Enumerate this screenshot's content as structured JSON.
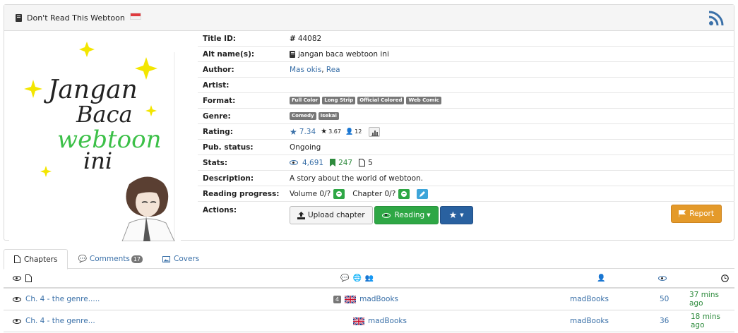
{
  "header": {
    "title": "Don't Read This Webtoon"
  },
  "cover": {
    "line1": "Jangan",
    "line2": "Baca",
    "line3": "webtoon",
    "line4": "ini"
  },
  "info": {
    "title_id_label": "Title ID:",
    "title_id_value": "44082",
    "alt_names_label": "Alt name(s):",
    "alt_names_value": "jangan baca webtoon ini",
    "author_label": "Author:",
    "authors": [
      "Mas okis",
      "Rea"
    ],
    "artist_label": "Artist:",
    "artist_value": "",
    "format_label": "Format:",
    "format_tags": [
      "Full Color",
      "Long Strip",
      "Official Colored",
      "Web Comic"
    ],
    "genre_label": "Genre:",
    "genre_tags": [
      "Comedy",
      "Isekai"
    ],
    "rating_label": "Rating:",
    "rating_bayesian": "7.34",
    "rating_mean": "3.67",
    "rating_users": "12",
    "pub_status_label": "Pub. status:",
    "pub_status_value": "Ongoing",
    "stats_label": "Stats:",
    "stats_views": "4,691",
    "stats_follows": "247",
    "stats_comments": "5",
    "description_label": "Description:",
    "description_value": "A story about the world of webtoon.",
    "progress_label": "Reading progress:",
    "progress_volume": "Volume 0/?",
    "progress_chapter": "Chapter 0/?",
    "actions_label": "Actions:"
  },
  "actions": {
    "upload_label": "Upload chapter",
    "reading_label": "Reading",
    "report_label": "Report"
  },
  "tabs": [
    {
      "label": "Chapters"
    },
    {
      "label": "Comments",
      "badge": "17"
    },
    {
      "label": "Covers"
    }
  ],
  "chapters": [
    {
      "title": "Ch. 4 - the genre.....",
      "comments": "4",
      "group": "madBooks",
      "uploader": "madBooks",
      "views": "50",
      "time": "37 mins ago"
    },
    {
      "title": "Ch. 4 - the genre...",
      "comments": "",
      "group": "madBooks",
      "uploader": "madBooks",
      "views": "36",
      "time": "18 mins ago"
    }
  ],
  "colors": {
    "link": "#3a70a8",
    "success": "#2ea745",
    "primary": "#2961a0",
    "warning": "#e49a2a",
    "tag_gray": "#777777"
  }
}
